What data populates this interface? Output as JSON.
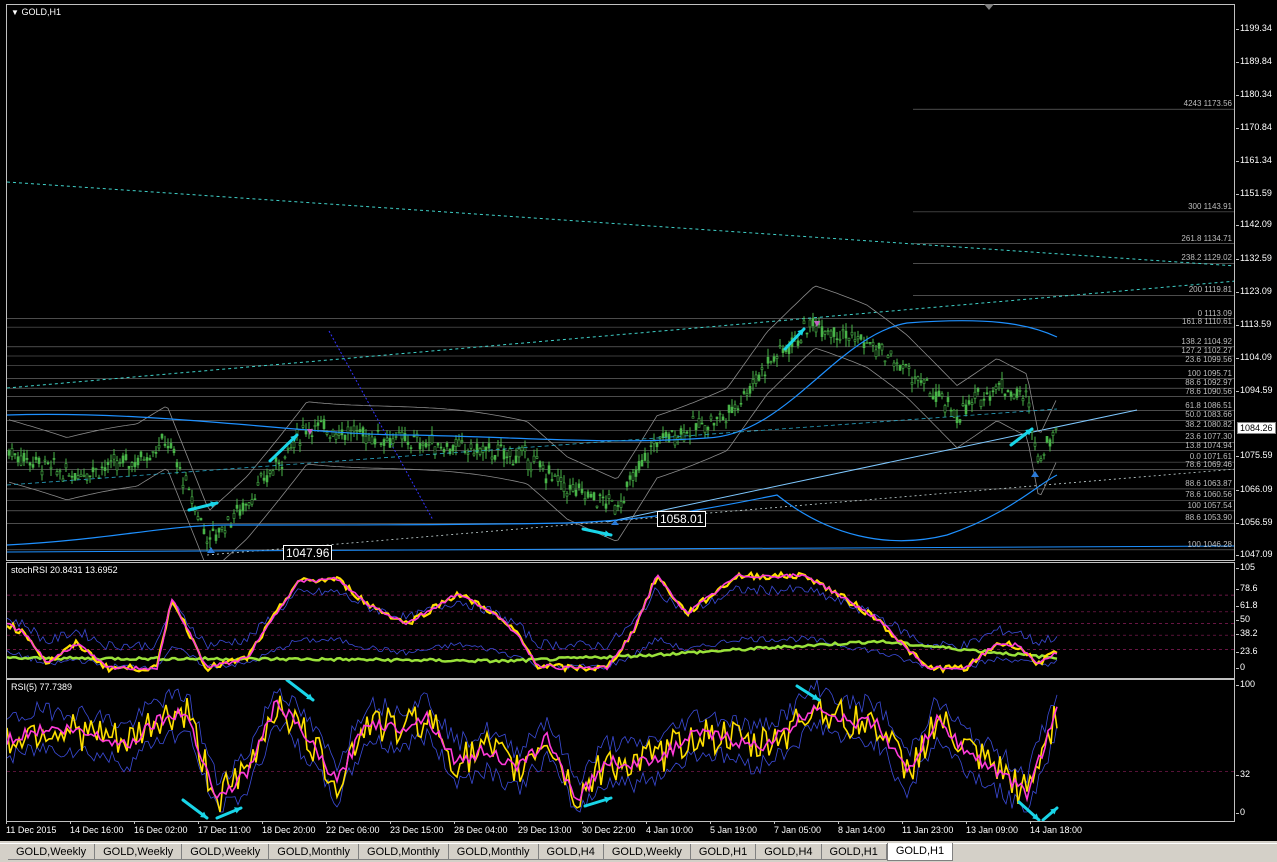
{
  "main_pane": {
    "title": "GOLD,H1",
    "price_ticks": [
      "1199.34",
      "1189.84",
      "1180.34",
      "1170.84",
      "1161.34",
      "1151.59",
      "1142.09",
      "1132.59",
      "1123.09",
      "1113.59",
      "1104.09",
      "1094.59",
      "1075.59",
      "1066.09",
      "1056.59",
      "1047.09"
    ],
    "current_price": "1084.26",
    "labels": {
      "low_1": "1047.96",
      "low_2": "1058.01"
    },
    "fib_levels": [
      {
        "text": "4243 1173.56"
      },
      {
        "text": "300 1143.91"
      },
      {
        "text": "261.8 1134.71"
      },
      {
        "text": "238.2 1129.02"
      },
      {
        "text": "200 1119.81"
      },
      {
        "text": "0 1113.09"
      },
      {
        "text": "161.8 1110.61"
      },
      {
        "text": "138.2 1104.92"
      },
      {
        "text": "127.2 1102.27"
      },
      {
        "text": "23.6 1099.56"
      },
      {
        "text": "100 1095.71"
      },
      {
        "text": "88.6 1092.97"
      },
      {
        "text": "78.6 1090.56"
      },
      {
        "text": "61.8 1086.51"
      },
      {
        "text": "50.0 1083.66"
      },
      {
        "text": "38.2 1080.82"
      },
      {
        "text": "23.6 1077.30"
      },
      {
        "text": "13.8 1074.94"
      },
      {
        "text": "0.0 1071.61"
      },
      {
        "text": "78.6 1069.46"
      },
      {
        "text": "88.6 1063.87"
      },
      {
        "text": "78.6 1060.56"
      },
      {
        "text": "100 1057.54"
      },
      {
        "text": "88.6 1053.90"
      },
      {
        "text": "100 1046.28"
      }
    ]
  },
  "stoch_pane": {
    "title": "stochRSI 20.8431 13.6952",
    "ticks": [
      "105",
      "78.6",
      "61.8",
      "50",
      "38.2",
      "23.6",
      "0"
    ]
  },
  "rsi_pane": {
    "title": "RSI(5) 77.7389",
    "ticks": [
      "100",
      "32",
      "0"
    ]
  },
  "time_axis": [
    "11 Dec 2015",
    "14 Dec 16:00",
    "16 Dec 02:00",
    "17 Dec 11:00",
    "18 Dec 20:00",
    "22 Dec 06:00",
    "23 Dec 15:00",
    "28 Dec 04:00",
    "29 Dec 13:00",
    "30 Dec 22:00",
    "4 Jan 10:00",
    "5 Jan 19:00",
    "7 Jan 05:00",
    "8 Jan 14:00",
    "11 Jan 23:00",
    "13 Jan 09:00",
    "14 Jan 18:00"
  ],
  "tabs": [
    "GOLD,Weekly",
    "GOLD,Weekly",
    "GOLD,Weekly",
    "GOLD,Monthly",
    "GOLD,Monthly",
    "GOLD,Monthly",
    "GOLD,H4",
    "GOLD,Weekly",
    "GOLD,H1",
    "GOLD,H4",
    "GOLD,H1",
    "GOLD,H1"
  ],
  "active_tab": 11,
  "colors": {
    "candle": "#49b449",
    "bands": "#1e90ff",
    "stoch_k": "#ff3bd9",
    "stoch_d": "#ffe000",
    "rsi": "#ffe000",
    "rsi_ma": "#ff3bd9",
    "arrow": "#19d5e8",
    "trend": "#7ec8ff"
  }
}
